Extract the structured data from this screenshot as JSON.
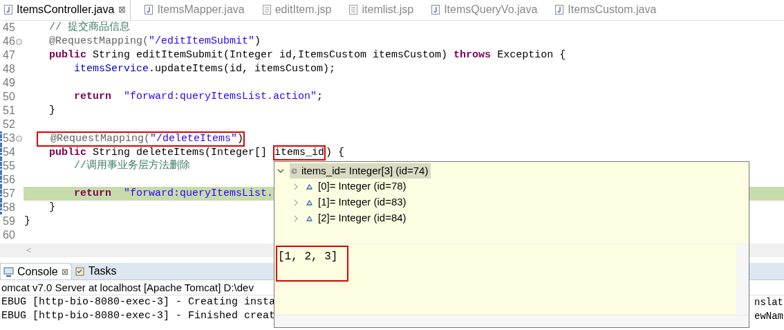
{
  "editor_tabs": [
    {
      "label": "ItemsController.java",
      "kind": "java",
      "selected": true,
      "close": "⊠"
    },
    {
      "label": "ItemsMapper.java",
      "kind": "java",
      "selected": false
    },
    {
      "label": "editItem.jsp",
      "kind": "jsp",
      "selected": false
    },
    {
      "label": "itemlist.jsp",
      "kind": "jsp",
      "selected": false
    },
    {
      "label": "ItemsQueryVo.java",
      "kind": "java",
      "selected": false
    },
    {
      "label": "ItemsCustom.java",
      "kind": "java",
      "selected": false
    }
  ],
  "code_lines": [
    {
      "number": "45",
      "tokens": [
        {
          "kind": "comment",
          "text": "    // 提交商品信息"
        }
      ]
    },
    {
      "number": "46",
      "fold": true,
      "tokens": [
        {
          "kind": "annotation",
          "text": "    @RequestMapping("
        },
        {
          "kind": "string",
          "text": "\"/editItemSubmit\""
        },
        {
          "kind": "plain",
          "text": ")"
        }
      ]
    },
    {
      "number": "47",
      "tokens": [
        {
          "kind": "keyword",
          "text": "    public"
        },
        {
          "kind": "plain",
          "text": " String editItemSubmit(Integer id,ItemsCustom itemsCustom) "
        },
        {
          "kind": "keyword",
          "text": "throws"
        },
        {
          "kind": "plain",
          "text": " Exception {"
        }
      ]
    },
    {
      "number": "48",
      "tokens": [
        {
          "kind": "field",
          "text": "        itemsService"
        },
        {
          "kind": "plain",
          "text": ".updateItems(id, itemsCustom);"
        }
      ]
    },
    {
      "number": "49"
    },
    {
      "number": "50",
      "tokens": [
        {
          "kind": "keyword",
          "text": "        return"
        },
        {
          "kind": "string",
          "text": "  \"forward:queryItemsList.action\""
        },
        {
          "kind": "plain",
          "text": ";"
        }
      ]
    },
    {
      "number": "51",
      "tokens": [
        {
          "kind": "plain",
          "text": "    }"
        }
      ]
    },
    {
      "number": "52"
    },
    {
      "number": "53",
      "fold": true,
      "debug": true,
      "tokens": [
        {
          "kind": "boxed",
          "children": [
            {
              "kind": "annotation",
              "text": "  @RequestMapping("
            },
            {
              "kind": "string",
              "text": "\"/deleteItems\""
            },
            {
              "kind": "plain",
              "text": ")"
            }
          ]
        }
      ]
    },
    {
      "number": "54",
      "debug": true,
      "tokens": [
        {
          "kind": "keyword",
          "text": "    public"
        },
        {
          "kind": "plain",
          "text": " String deleteItems(Integer[] "
        },
        {
          "kind": "boxed",
          "children": [
            {
              "kind": "plain",
              "text": "items_id"
            }
          ]
        },
        {
          "kind": "plain",
          "text": ") {"
        }
      ]
    },
    {
      "number": "55",
      "debug": true,
      "tokens": [
        {
          "kind": "comment",
          "text": "        //调用事业务层方法删除"
        }
      ]
    },
    {
      "number": "56",
      "debug": true
    },
    {
      "number": "57",
      "debug": true,
      "current": true,
      "tokens": [
        {
          "kind": "keyword",
          "text": "        return"
        },
        {
          "kind": "string",
          "text": "  \"forward:queryItemsList."
        }
      ]
    },
    {
      "number": "58",
      "debug": true,
      "tokens": [
        {
          "kind": "plain",
          "text": "    }"
        }
      ]
    },
    {
      "number": "59",
      "tokens": [
        {
          "kind": "plain",
          "text": "}"
        }
      ]
    },
    {
      "number": "60"
    }
  ],
  "editor_scroll_left": "<",
  "console_tabs": [
    {
      "label": "Console",
      "selected": true,
      "close": "⊠"
    },
    {
      "label": "Tasks",
      "selected": false
    }
  ],
  "console": {
    "title": "omcat v7.0 Server at localhost [Apache Tomcat] D:\\dev",
    "lines": [
      {
        "left": "EBUG [http-bio-8080-exec-3] - Creating insta",
        "right": "nslat"
      },
      {
        "left": "EBUG [http-bio-8080-exec-3] - Finished creat",
        "right": "ewNam"
      }
    ]
  },
  "inspector": {
    "root": {
      "label": "items_id= Integer[3]  (id=74)",
      "expanded": true,
      "selected": true
    },
    "children": [
      {
        "label": "[0]= Integer  (id=78)",
        "expanded": false
      },
      {
        "label": "[1]= Integer  (id=83)",
        "expanded": false
      },
      {
        "label": "[2]= Integer  (id=84)",
        "expanded": false
      }
    ],
    "detail": "[1, 2, 3]"
  }
}
